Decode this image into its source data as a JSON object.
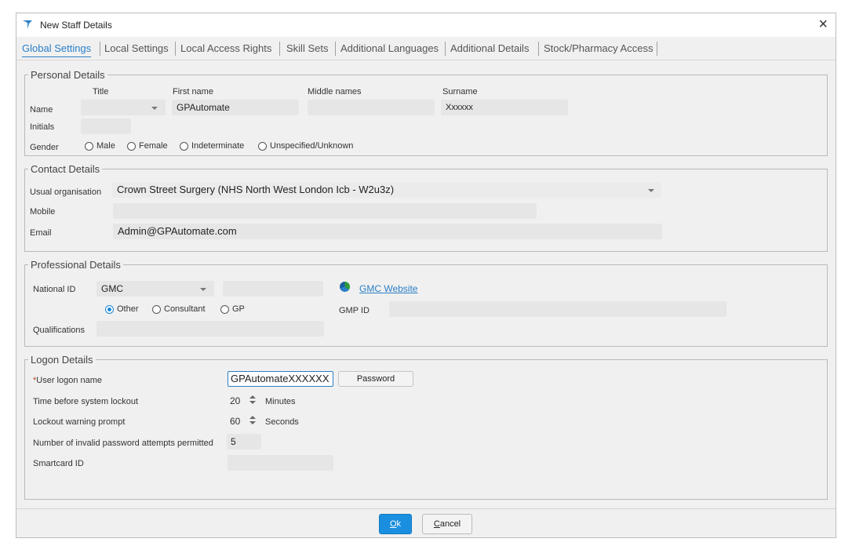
{
  "window": {
    "title": "New Staff Details",
    "close_glyph": "×"
  },
  "tabs": [
    {
      "label": "Global Settings"
    },
    {
      "label": "Local Settings"
    },
    {
      "label": "Local Access Rights"
    },
    {
      "label": "Skill Sets"
    },
    {
      "label": "Additional Languages"
    },
    {
      "label": "Additional Details"
    },
    {
      "label": "Stock/Pharmacy Access"
    }
  ],
  "personal": {
    "legend": "Personal Details",
    "col_title": "Title",
    "col_first": "First name",
    "col_middle": "Middle names",
    "col_surname": "Surname",
    "name_label": "Name",
    "title_value": "",
    "first_value": "GPAutomate",
    "middle_value": "",
    "surname_value": "Xxxxxx",
    "initials_label": "Initials",
    "initials_value": "",
    "gender_label": "Gender",
    "gender_options": [
      "Male",
      "Female",
      "Indeterminate",
      "Unspecified/Unknown"
    ]
  },
  "contact": {
    "legend": "Contact Details",
    "org_label": "Usual organisation",
    "org_value": "Crown Street Surgery (NHS North West London Icb - W2u3z)",
    "mobile_label": "Mobile",
    "mobile_value": "",
    "email_label": "Email",
    "email_value": "Admin@GPAutomate.com"
  },
  "professional": {
    "legend": "Professional Details",
    "nid_label": "National ID",
    "nid_type": "GMC",
    "nid_value": "",
    "website_link": "GMC Website",
    "role_options": [
      "Other",
      "Consultant",
      "GP"
    ],
    "role_selected": "Other",
    "gmp_label": "GMP ID",
    "gmp_value": "",
    "qual_label": "Qualifications",
    "qual_value": ""
  },
  "logon": {
    "legend": "Logon Details",
    "required_mark": "*",
    "user_label": "User logon name",
    "user_value": "GPAutomateXXXXXX",
    "password_button": "Password",
    "lockout_label": "Time before system lockout",
    "lockout_value": "20",
    "lockout_unit": "Minutes",
    "warning_label": "Lockout warning prompt",
    "warning_value": "60",
    "warning_unit": "Seconds",
    "attempts_label": "Number of invalid password attempts permitted",
    "attempts_value": "5",
    "smartcard_label": "Smartcard ID",
    "smartcard_value": ""
  },
  "footer": {
    "ok_label": "Ok",
    "ok_mnemonic": "O",
    "ok_rest": "k",
    "cancel_mnemonic": "C",
    "cancel_rest": "ancel"
  },
  "colors": {
    "accent": "#1a8fe0",
    "link": "#2a7fc7",
    "required": "#c0392b"
  }
}
